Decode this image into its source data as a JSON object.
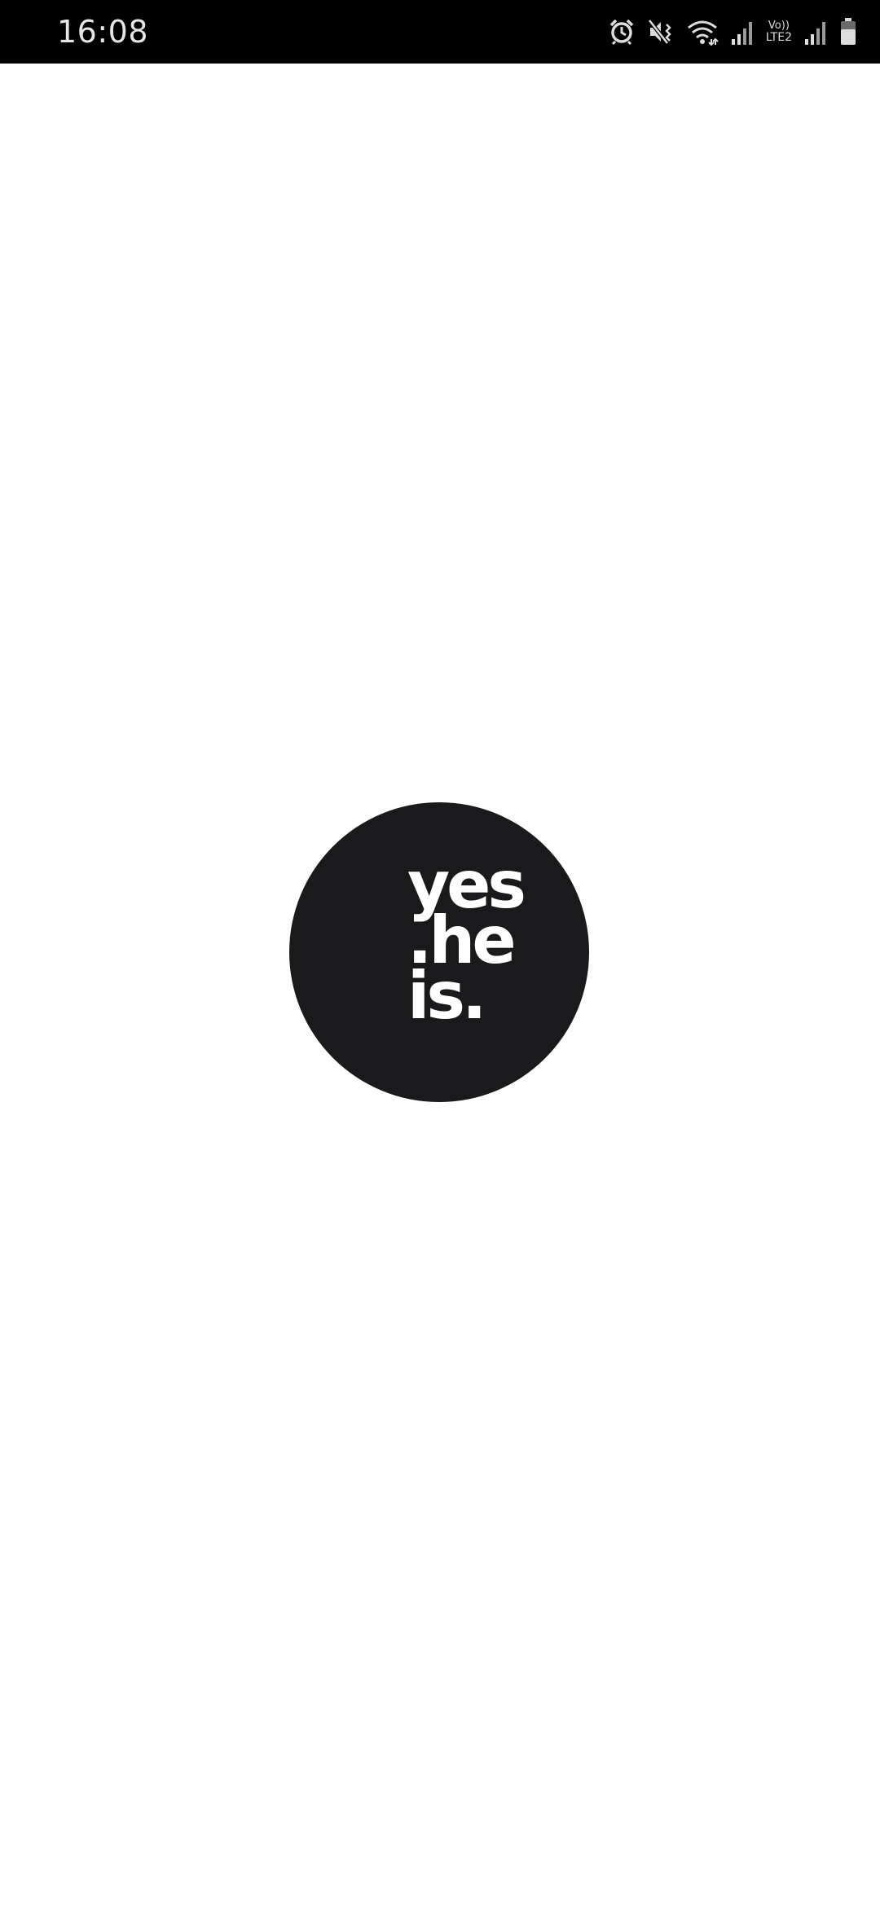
{
  "status_bar": {
    "time": "16:08",
    "lte_top": "Vo))",
    "lte_bottom": "LTE2",
    "icons": [
      "alarm-icon",
      "mute-icon",
      "wifi-icon",
      "signal-icon",
      "signal-icon",
      "battery-icon"
    ]
  },
  "logo": {
    "line1": "yes",
    "line2": ".he",
    "line3": "is.",
    "circle_color": "#1a191b",
    "text_color": "#ffffff"
  }
}
